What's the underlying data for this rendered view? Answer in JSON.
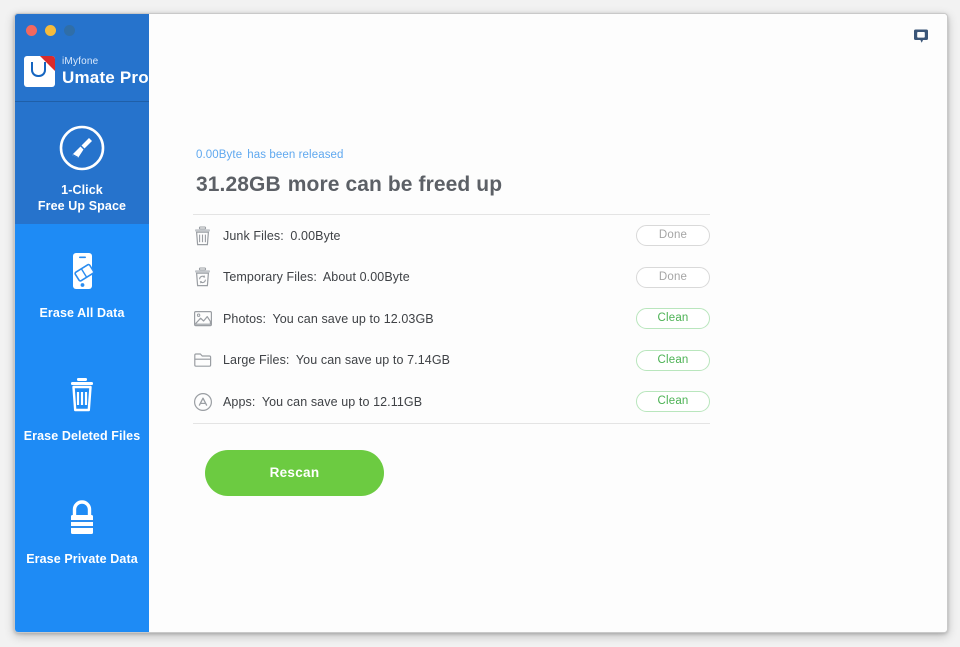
{
  "window": {
    "traffic_lights": [
      "close",
      "minimize",
      "zoom"
    ]
  },
  "sidebar": {
    "brand": {
      "sub": "iMyfone",
      "title": "Umate Pro",
      "logo_icon": "umate-logo-icon"
    },
    "items": [
      {
        "label": "1-Click\nFree Up Space",
        "icon": "broom-circle-icon",
        "active": true
      },
      {
        "label": "Erase All Data",
        "icon": "phone-erase-icon",
        "active": false
      },
      {
        "label": "Erase Deleted Files",
        "icon": "trash-icon",
        "active": false
      },
      {
        "label": "Erase Private Data",
        "icon": "lock-icon",
        "active": false
      }
    ]
  },
  "main": {
    "feedback_icon": "feedback-bubble-icon",
    "released": {
      "amount": "0.00Byte",
      "text": "has been released"
    },
    "headline": {
      "value": "31.28GB",
      "text": "more can be freed up"
    },
    "rows": [
      {
        "icon": "trash-icon",
        "label": "Junk Files:",
        "value": "0.00Byte",
        "action": "Done",
        "action_type": "done"
      },
      {
        "icon": "trash-recycle-icon",
        "label": "Temporary Files:",
        "value": "About 0.00Byte",
        "action": "Done",
        "action_type": "done"
      },
      {
        "icon": "photo-icon",
        "label": "Photos:",
        "value": "You can save up to 12.03GB",
        "action": "Clean",
        "action_type": "clean"
      },
      {
        "icon": "folder-icon",
        "label": "Large Files:",
        "value": "You can save up to 7.14GB",
        "action": "Clean",
        "action_type": "clean"
      },
      {
        "icon": "appstore-icon",
        "label": "Apps:",
        "value": "You can save up to 12.11GB",
        "action": "Clean",
        "action_type": "clean"
      }
    ],
    "rescan_label": "Rescan"
  },
  "colors": {
    "sidebar_blue": "#1e8bf5",
    "sidebar_active_blue": "#2673cc",
    "accent_green": "#6ccb41",
    "clean_green": "#4cb254",
    "link_blue": "#5fa8ef",
    "headline_gray": "#5c6066"
  }
}
